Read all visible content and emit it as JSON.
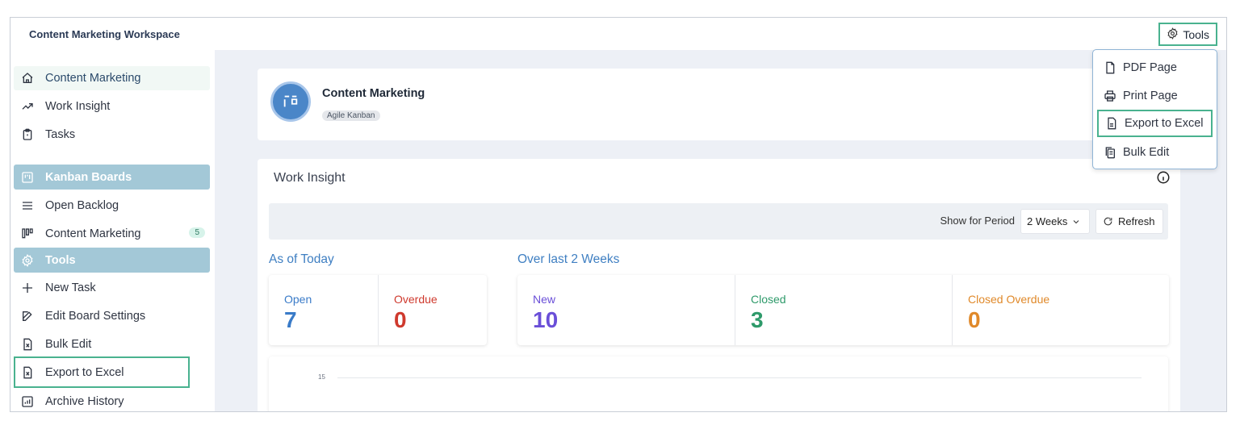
{
  "workspace": {
    "title": "Content Marketing Workspace"
  },
  "tools_button": {
    "label": "Tools",
    "icon": "gear-icon"
  },
  "sidebar": {
    "items": [
      {
        "label": "Content Marketing",
        "icon": "home-icon"
      },
      {
        "label": "Work Insight",
        "icon": "trend-icon"
      },
      {
        "label": "Tasks",
        "icon": "clipboard-icon"
      },
      {
        "label": "Kanban Boards",
        "icon": "kanban-icon"
      },
      {
        "label": "Open Backlog",
        "icon": "list-icon"
      },
      {
        "label": "Content Marketing",
        "icon": "board-columns-icon",
        "badge": "5"
      },
      {
        "label": "Tools",
        "icon": "gear-icon"
      },
      {
        "label": "New Task",
        "icon": "plus-icon"
      },
      {
        "label": "Edit Board Settings",
        "icon": "edit-icon"
      },
      {
        "label": "Bulk Edit",
        "icon": "excel-file-icon"
      },
      {
        "label": "Export to Excel",
        "icon": "excel-file-icon"
      },
      {
        "label": "Archive History",
        "icon": "chart-box-icon"
      }
    ]
  },
  "board": {
    "title": "Content Marketing",
    "tag": "Agile Kanban",
    "avatar_color": "#4a86c8"
  },
  "insight": {
    "title": "Work Insight",
    "filter_label": "Show for Period",
    "period_value": "2 Weeks",
    "refresh_label": "Refresh",
    "today": {
      "label": "As of Today",
      "stats": [
        {
          "label": "Open",
          "value": "7",
          "color": "#3a7bc8"
        },
        {
          "label": "Overdue",
          "value": "0",
          "color": "#cf3a2e"
        }
      ]
    },
    "period": {
      "label": "Over last 2 Weeks",
      "stats": [
        {
          "label": "New",
          "value": "10",
          "color": "#6a4fd8"
        },
        {
          "label": "Closed",
          "value": "3",
          "color": "#2e9a6a"
        },
        {
          "label": "Closed Overdue",
          "value": "0",
          "color": "#e0892a"
        }
      ]
    },
    "chart_tick": "15"
  },
  "tools_menu": {
    "items": [
      {
        "label": "PDF Page",
        "icon": "file-icon"
      },
      {
        "label": "Print Page",
        "icon": "printer-icon"
      },
      {
        "label": "Export to Excel",
        "icon": "file-text-icon"
      },
      {
        "label": "Bulk Edit",
        "icon": "copy-icon"
      }
    ]
  },
  "colors": {
    "accent_highlight": "#49b28f",
    "section_bg": "#a3c8d7",
    "main_bg": "#edf0f6"
  }
}
